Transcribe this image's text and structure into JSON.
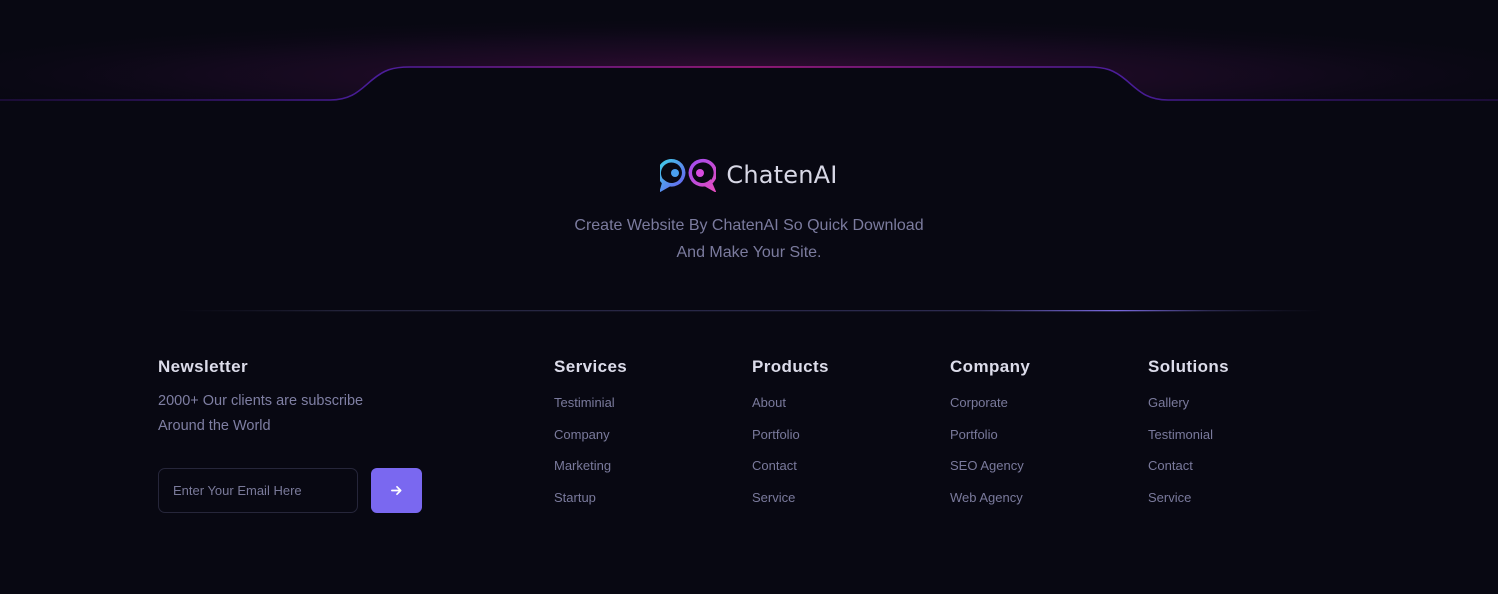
{
  "brand": {
    "name": "ChatenAI",
    "logo_icon": "chat-bubbles-logo-icon"
  },
  "tagline": {
    "line1": "Create Website By ChatenAI So Quick Download",
    "line2": "And Make Your Site."
  },
  "newsletter": {
    "title": "Newsletter",
    "text_line1": "2000+ Our clients are subscribe",
    "text_line2": "Around the World",
    "email_placeholder": "Enter Your Email Here",
    "submit_icon": "arrow-right-icon"
  },
  "columns": [
    {
      "title": "Services",
      "links": [
        "Testiminial",
        "Company",
        "Marketing",
        "Startup"
      ]
    },
    {
      "title": "Products",
      "links": [
        "About",
        "Portfolio",
        "Contact",
        "Service"
      ]
    },
    {
      "title": "Company",
      "links": [
        "Corporate",
        "Portfolio",
        "SEO Agency",
        "Web Agency"
      ]
    },
    {
      "title": "Solutions",
      "links": [
        "Gallery",
        "Testimonial",
        "Contact",
        "Service"
      ]
    }
  ],
  "colors": {
    "background": "#080812",
    "accent": "#7a68f0",
    "glow_pink": "#c21d8a",
    "glow_purple": "#4a1a8a"
  }
}
